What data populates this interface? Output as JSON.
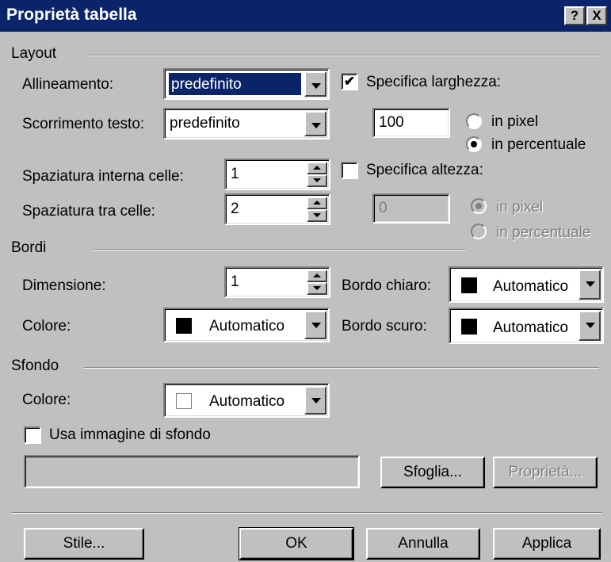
{
  "window": {
    "title": "Proprietà tabella",
    "help_button": "?",
    "close_button": "X"
  },
  "layout": {
    "group_label": "Layout",
    "alignment_label": "Allineamento:",
    "alignment_value": "predefinito",
    "text_wrap_label": "Scorrimento testo:",
    "text_wrap_value": "predefinito",
    "cell_padding_label": "Spaziatura interna celle:",
    "cell_padding_value": "1",
    "cell_spacing_label": "Spaziatura tra celle:",
    "cell_spacing_value": "2",
    "specify_width_label": "Specifica larghezza:",
    "specify_width_checked": true,
    "width_value": "100",
    "width_pixel_label": "in pixel",
    "width_percent_label": "in percentuale",
    "width_unit_selected": "in percentuale",
    "specify_height_label": "Specifica altezza:",
    "specify_height_checked": false,
    "height_value": "0",
    "height_pixel_label": "in pixel",
    "height_percent_label": "in percentuale"
  },
  "borders": {
    "group_label": "Bordi",
    "size_label": "Dimensione:",
    "size_value": "1",
    "color_label": "Colore:",
    "color_value": "Automatico",
    "color_swatch": "#000000",
    "light_border_label": "Bordo chiaro:",
    "light_border_value": "Automatico",
    "light_border_swatch": "#000000",
    "dark_border_label": "Bordo scuro:",
    "dark_border_value": "Automatico",
    "dark_border_swatch": "#000000"
  },
  "background": {
    "group_label": "Sfondo",
    "color_label": "Colore:",
    "color_value": "Automatico",
    "color_swatch": "#ffffff",
    "use_image_label": "Usa immagine di sfondo",
    "use_image_checked": false,
    "image_path": "",
    "browse_button": "Sfoglia...",
    "properties_button": "Proprietà..."
  },
  "footer": {
    "style_button": "Stile...",
    "ok_button": "OK",
    "cancel_button": "Annulla",
    "apply_button": "Applica"
  },
  "colors": {
    "titlebar": "#0a246a",
    "face": "#c0c0c0"
  }
}
